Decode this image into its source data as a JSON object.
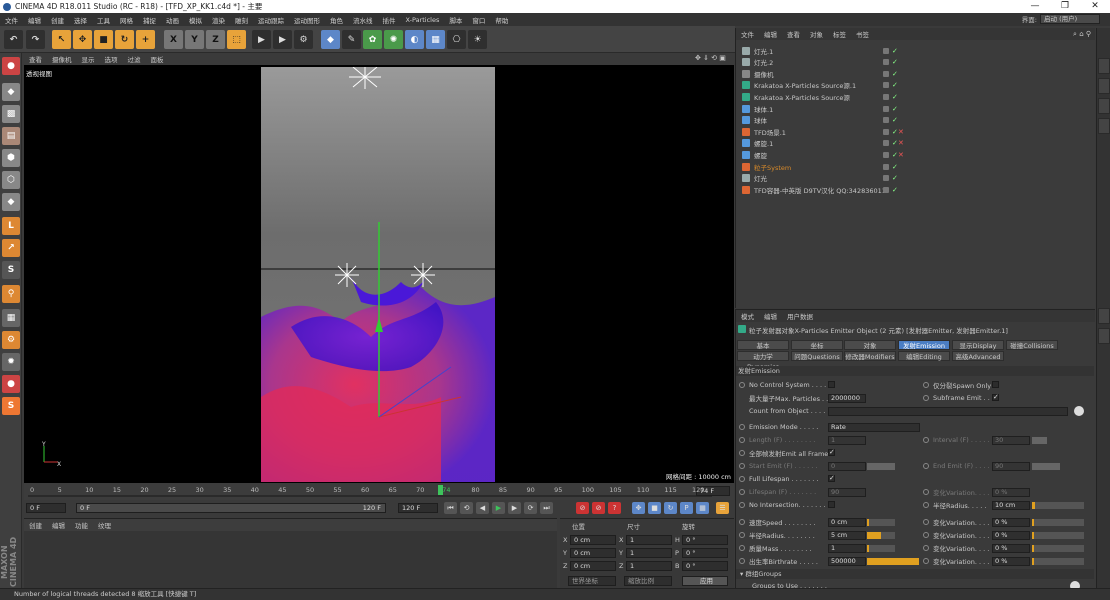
{
  "window": {
    "title": "CINEMA 4D R18.011 Studio (RC - R18) - [TFD_XP_KK1.c4d *] - 主要",
    "controls": [
      "—",
      "❐",
      "✕"
    ]
  },
  "menu": {
    "items": [
      "文件",
      "编辑",
      "创建",
      "选择",
      "工具",
      "网格",
      "捕捉",
      "动画",
      "模拟",
      "渲染",
      "雕刻",
      "运动跟踪",
      "运动图形",
      "角色",
      "流水线",
      "插件",
      "X-Particles",
      "脚本",
      "窗口",
      "帮助"
    ],
    "layout_label": "界面:",
    "layout_value": "启动 (用户)"
  },
  "viewport": {
    "menu": [
      "查看",
      "摄像机",
      "显示",
      "选项",
      "过滤",
      "面板"
    ],
    "label": "透视视图",
    "grid": "网格间距 : 10000 cm"
  },
  "timeline": {
    "ticks": [
      "0",
      "5",
      "10",
      "15",
      "20",
      "25",
      "30",
      "35",
      "40",
      "45",
      "50",
      "55",
      "60",
      "65",
      "70",
      "74",
      "80",
      "85",
      "90",
      "95",
      "100",
      "105",
      "110",
      "115",
      "120"
    ],
    "current": "74 F",
    "current_value": 74,
    "start": "0 F",
    "field2": "0 F",
    "end_inner": "120 F",
    "end": "120 F",
    "fps": "120 F"
  },
  "materials": {
    "menu": [
      "创建",
      "编辑",
      "功能",
      "纹理"
    ]
  },
  "coords": {
    "headers": [
      "位置",
      "尺寸",
      "旋转"
    ],
    "rows": [
      {
        "axis": "X",
        "pos": "0 cm",
        "size_axis": "X",
        "size": "1",
        "rot_axis": "H",
        "rot": "0 °"
      },
      {
        "axis": "Y",
        "pos": "0 cm",
        "size_axis": "Y",
        "size": "1",
        "rot_axis": "P",
        "rot": "0 °"
      },
      {
        "axis": "Z",
        "pos": "0 cm",
        "size_axis": "Z",
        "size": "1",
        "rot_axis": "B",
        "rot": "0 °"
      }
    ],
    "mode1": "世界坐标",
    "mode2": "缩放比例",
    "apply": "应用"
  },
  "objects": {
    "menu": [
      "文件",
      "编辑",
      "查看",
      "对象",
      "标签",
      "书签"
    ],
    "rows": [
      {
        "name": "灯光.1",
        "color": "#9aa"
      },
      {
        "name": "灯光.2",
        "color": "#9aa"
      },
      {
        "name": "摄像机",
        "color": "#888"
      },
      {
        "name": "Krakatoa X-Particles Source源.1",
        "color": "#3a8"
      },
      {
        "name": "Krakatoa X-Particles Source源",
        "color": "#3a8"
      },
      {
        "name": "球体.1",
        "color": "#59d"
      },
      {
        "name": "球体",
        "color": "#59d"
      },
      {
        "name": "TFD场景.1",
        "color": "#d63"
      },
      {
        "name": "螺旋.1",
        "color": "#59d"
      },
      {
        "name": "螺旋",
        "color": "#59d"
      },
      {
        "name": "粒子System",
        "color": "#d63"
      },
      {
        "name": "灯光",
        "color": "#9aa"
      },
      {
        "name": "TFD容器-中英版 D9TV汉化 QQ:342836011",
        "color": "#d63"
      }
    ]
  },
  "attributes": {
    "menu": [
      "模式",
      "编辑",
      "用户数据"
    ],
    "title": "粒子发射器对象X-Particles Emitter Object (2 元素) [发射器Emitter, 发射器Emitter.1]",
    "tabs1": [
      "基本",
      "坐标",
      "对象",
      "发射Emission",
      "显示Display",
      "碰撞Collisions"
    ],
    "tabs2": [
      "动力学Dynamics",
      "问题Questions",
      "修改器Modifiers",
      "编辑Editing",
      "高级Advanced"
    ],
    "section": "发射Emission",
    "no_control": "No Control System . . . . .",
    "spawn_only": "仅分裂Spawn Only",
    "max_particles": "最大量子Max. Particles . . .",
    "max_value": "2000000",
    "subframe": "Subframe Emit . . .",
    "count_from": "Count from Object . . . . .",
    "emission_mode": "Emission Mode . . . . .",
    "mode_value": "Rate",
    "length": "Length (F) . . . . . . . .",
    "length_val": "1",
    "interval": "Interval (F) . . . . .",
    "interval_val": "30",
    "emit_all": "全部帧发射Emit all Frames",
    "start_emit": "Start Emit (F) . . . . . .",
    "start_val": "0",
    "end_emit": "End Emit (F) . . . . .",
    "end_val": "90",
    "full_life": "Full Lifespan . . . . . . .",
    "lifespan": "Lifespan (F) . . . . . . .",
    "lifespan_val": "90",
    "variation": "变化Variation. . . . .",
    "var_val": "0 %",
    "no_intersect": "No Intersection. . . . . . .",
    "radius_label": "半径Radius. . . . .",
    "radius_val": "10 cm",
    "speed": "速度Speed . . . . . . . .",
    "speed_val": "0 cm",
    "radius2": "半径Radius. . . . . . . .",
    "radius2_val": "5 cm",
    "mass": "质量Mass . . . . . . . .",
    "mass_val": "1",
    "birthrate": "出生率Birthrate . . . . .",
    "birthrate_val": "500000",
    "groups": "群组Groups",
    "groups_use": "Groups to Use . . . . . . ."
  },
  "status": "Number of logical threads detected 8      缩放工具 [快捷键 T]",
  "brand": "MAXON CINEMA 4D"
}
